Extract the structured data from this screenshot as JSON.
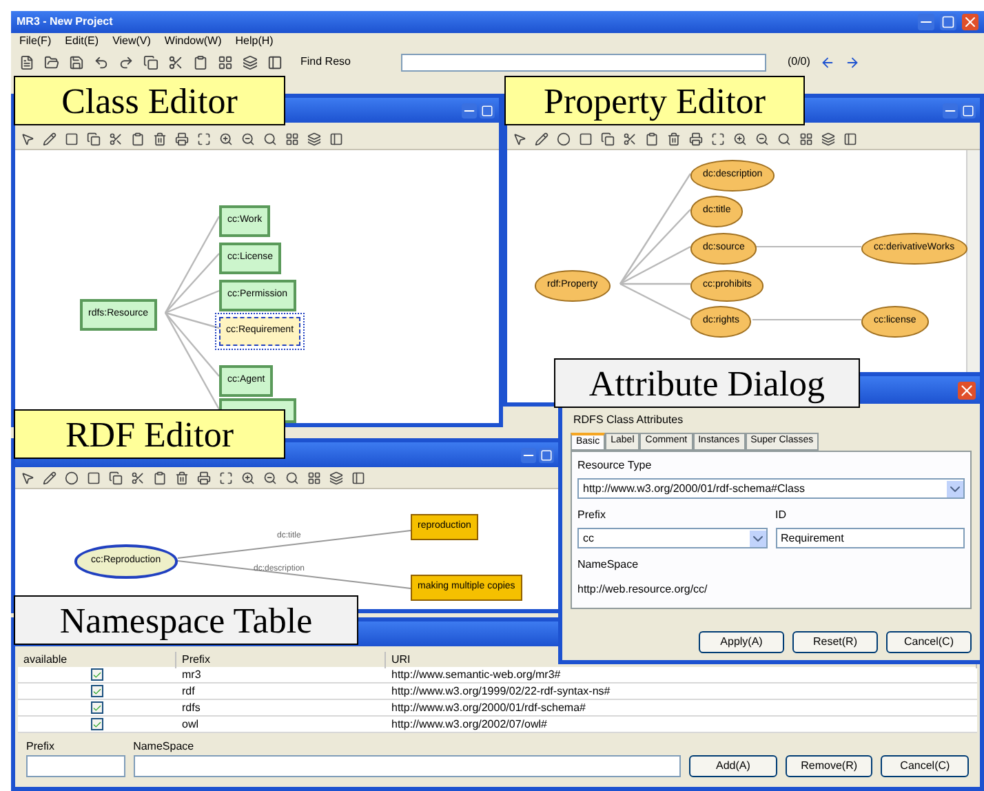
{
  "window": {
    "title": "MR3 - New Project"
  },
  "menu": [
    "File(F)",
    "Edit(E)",
    "View(V)",
    "Window(W)",
    "Help(H)"
  ],
  "toolbar": {
    "find_label": "Find Reso",
    "find_count": "(0/0)"
  },
  "class_editor": {
    "nodes": [
      {
        "label": "rdfs:Resource",
        "selected": false
      },
      {
        "label": "cc:Work",
        "selected": false
      },
      {
        "label": "cc:License",
        "selected": false
      },
      {
        "label": "cc:Permission",
        "selected": false
      },
      {
        "label": "cc:Requirement",
        "selected": true
      },
      {
        "label": "cc:Agent",
        "selected": false
      }
    ]
  },
  "property_editor": {
    "nodes": [
      "rdf:Property",
      "dc:description",
      "dc:title",
      "dc:source",
      "cc:prohibits",
      "dc:rights",
      "cc:derivativeWorks",
      "cc:license"
    ]
  },
  "rdf_editor": {
    "resource": {
      "label": "cc:Reproduction",
      "selected": true
    },
    "properties": [
      {
        "label": "dc:title",
        "value": "reproduction"
      },
      {
        "label": "dc:description",
        "value": "making multiple copies"
      }
    ]
  },
  "attribute_dialog": {
    "heading": "RDFS Class Attributes",
    "tabs": [
      {
        "label": "Basic",
        "selected": true
      },
      {
        "label": "Label",
        "selected": false
      },
      {
        "label": "Comment",
        "selected": false
      },
      {
        "label": "Instances",
        "selected": false
      },
      {
        "label": "Super Classes",
        "selected": false
      }
    ],
    "resource_type_label": "Resource Type",
    "resource_type": "http://www.w3.org/2000/01/rdf-schema#Class",
    "prefix_label": "Prefix",
    "prefix": "cc",
    "id_label": "ID",
    "id": "Requirement",
    "namespace_label": "NameSpace",
    "namespace": "http://web.resource.org/cc/",
    "buttons": [
      "Apply(A)",
      "Reset(R)",
      "Cancel(C)"
    ]
  },
  "namespace_table": {
    "columns": [
      "available",
      "Prefix",
      "URI"
    ],
    "rows": [
      {
        "available": true,
        "prefix": "mr3",
        "uri": "http://www.semantic-web.org/mr3#"
      },
      {
        "available": true,
        "prefix": "rdf",
        "uri": "http://www.w3.org/1999/02/22-rdf-syntax-ns#"
      },
      {
        "available": true,
        "prefix": "rdfs",
        "uri": "http://www.w3.org/2000/01/rdf-schema#"
      },
      {
        "available": true,
        "prefix": "owl",
        "uri": "http://www.w3.org/2002/07/owl#"
      }
    ],
    "prefix_label": "Prefix",
    "namespace_label": "NameSpace",
    "buttons": [
      "Add(A)",
      "Remove(R)",
      "Cancel(C)"
    ]
  },
  "annotations": [
    {
      "text": "Class Editor",
      "color": "#ffff99"
    },
    {
      "text": "Property Editor",
      "color": "#ffff99"
    },
    {
      "text": "Attribute Dialog",
      "color": "#f2f2f2"
    },
    {
      "text": "RDF Editor",
      "color": "#ffff99"
    },
    {
      "text": "Namespace Table",
      "color": "#f2f2f2"
    }
  ]
}
